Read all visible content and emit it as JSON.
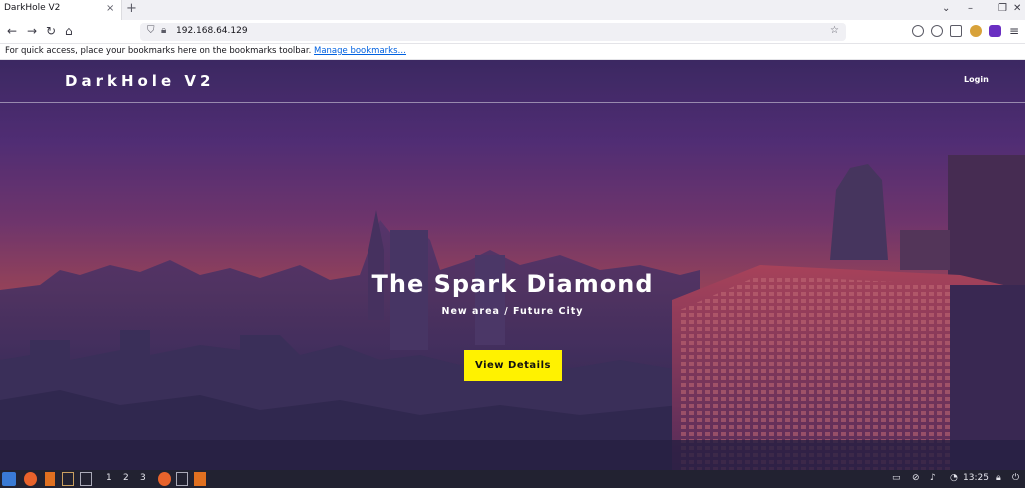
{
  "browser": {
    "tab_title": "DarkHole V2",
    "tab_close_glyph": "×",
    "new_tab_glyph": "+",
    "url": "192.168.64.129",
    "bookmarks_text": "For quick access, place your bookmarks here on the bookmarks toolbar.",
    "bookmarks_link": "Manage bookmarks…"
  },
  "site": {
    "brand": "DarkHole V2",
    "login_label": "Login"
  },
  "hero": {
    "title": "The Spark Diamond",
    "subtitle": "New area / Future City",
    "cta_label": "View Details"
  },
  "taskbar": {
    "workspaces": [
      "1",
      "2",
      "3"
    ],
    "clock": "13:25"
  },
  "colors": {
    "cta_background": "#fff200",
    "accent_link": "#0061e0"
  }
}
